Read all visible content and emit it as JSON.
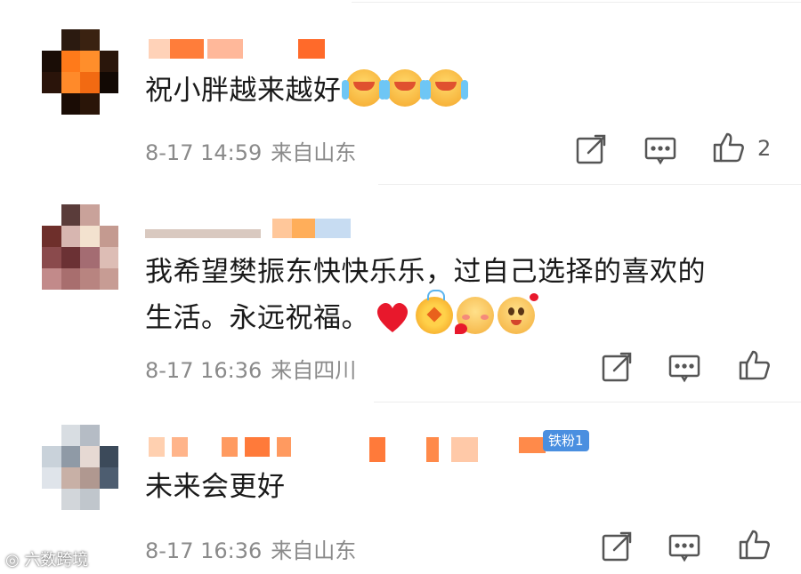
{
  "comments": [
    {
      "text": "祝小胖越来越好",
      "time": "8-17 14:59",
      "location": "来自山东",
      "like_count": "2",
      "emojis": [
        "laughing-tears-emoji",
        "laughing-tears-emoji",
        "laughing-tears-emoji"
      ]
    },
    {
      "text_line1": "我希望樊振东快快乐乐，过自己选择的喜欢的",
      "text_line2": "生活。永远祝福。",
      "time": "8-17 16:36",
      "location": "来自四川",
      "emojis": [
        "red-heart-emoji",
        "medal-emoji",
        "blushing-heart-emoji",
        "in-love-emoji"
      ]
    },
    {
      "text": "未来会更好",
      "time": "8-17 16:36",
      "location": "来自山东",
      "badge": "铁粉1"
    }
  ],
  "icons": {
    "repost": "repost-icon",
    "comment": "comment-icon",
    "like": "thumbs-up-icon"
  },
  "colors": {
    "text": "#1a1a1a",
    "meta": "#8a8a8a",
    "icon": "#555555",
    "badge": "#4a8fe0",
    "name_orange": "#ff8a3d",
    "name_blue": "#9cc3ee"
  },
  "watermark": "六数跨境"
}
